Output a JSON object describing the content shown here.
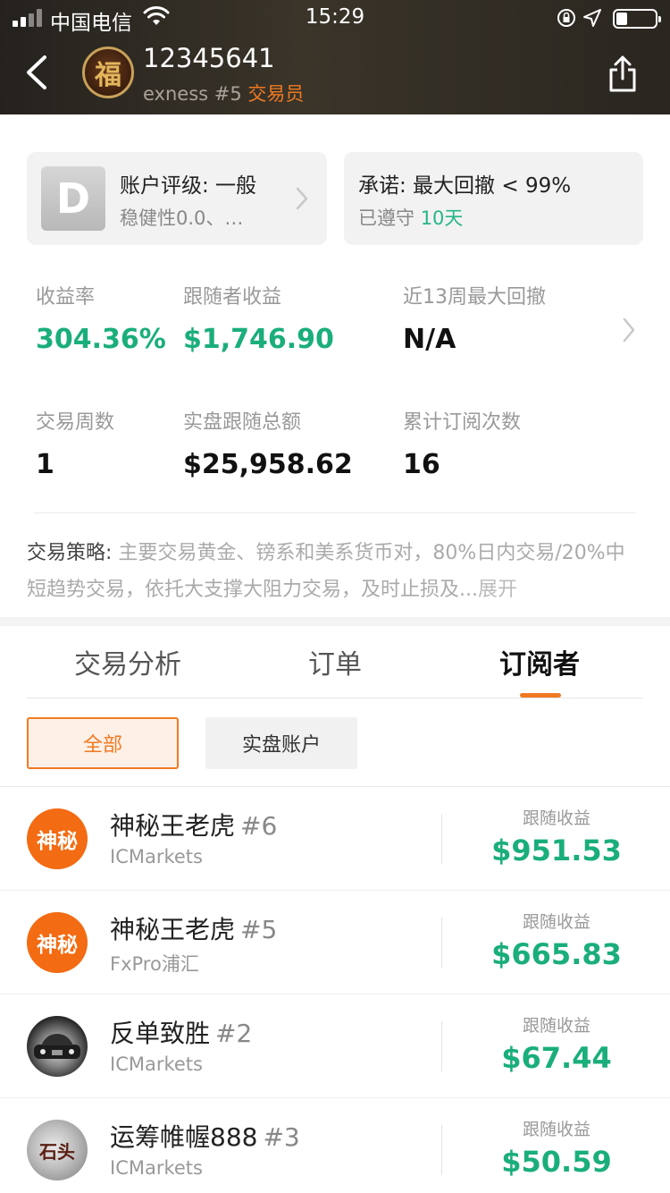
{
  "status_bar": {
    "carrier": "中国电信",
    "time": "15:29"
  },
  "header": {
    "account_id": "12345641",
    "broker_rank": "exness #5",
    "role": "交易员",
    "avatar_char": "福"
  },
  "rating_card": {
    "grade": "D",
    "title": "账户评级: 一般",
    "subtitle": "稳健性0.0、…"
  },
  "promise_card": {
    "title": "承诺: 最大回撤 < 99%",
    "kept_prefix": "已遵守",
    "kept_days": "10天"
  },
  "stats": {
    "return_label": "收益率",
    "return_value": "304.36%",
    "follower_profit_label": "跟随者收益",
    "follower_profit_value": "$1,746.90",
    "max_drawdown_label": "近13周最大回撤",
    "max_drawdown_value": "N/A",
    "weeks_label": "交易周数",
    "weeks_value": "1",
    "real_follow_label": "实盘跟随总额",
    "real_follow_value": "$25,958.62",
    "subscriptions_label": "累计订阅次数",
    "subscriptions_value": "16"
  },
  "strategy": {
    "label": "交易策略:",
    "text": " 主要交易黄金、镑系和美系货币对，80%日内交易/20%中短趋势交易，依托大支撑大阻力交易，及时止损及...",
    "expand": "展开"
  },
  "tabs": [
    {
      "label": "交易分析"
    },
    {
      "label": "订单"
    },
    {
      "label": "订阅者"
    }
  ],
  "filters": {
    "all": "全部",
    "real": "实盘账户"
  },
  "subscribers": [
    {
      "name": "神秘王老虎",
      "rank": "#6",
      "broker": "ICMarkets",
      "avatar_text": "神秘",
      "earn_label": "跟随收益",
      "earn_value": "$951.53"
    },
    {
      "name": "神秘王老虎",
      "rank": "#5",
      "broker": "FxPro浦汇",
      "avatar_text": "神秘",
      "earn_label": "跟随收益",
      "earn_value": "$665.83"
    },
    {
      "name": "反单致胜",
      "rank": "#2",
      "broker": "ICMarkets",
      "avatar_text": "",
      "earn_label": "跟随收益",
      "earn_value": "$67.44"
    },
    {
      "name": "运筹帷幄888",
      "rank": "#3",
      "broker": "ICMarkets",
      "avatar_text": "石头",
      "earn_label": "跟随收益",
      "earn_value": "$50.59"
    }
  ],
  "colors": {
    "accent_orange": "#f07a23",
    "profit_green": "#1aae7a",
    "header_dark": "#2a2620"
  }
}
